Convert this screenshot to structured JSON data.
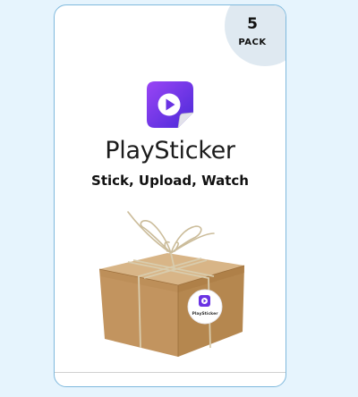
{
  "card": {
    "brand_name": "PlaySticker",
    "tagline": "Stick, Upload, Watch",
    "pack": {
      "count": "5",
      "label": "PACK"
    }
  },
  "parcel_sticker": {
    "brand_name": "PlaySticker"
  },
  "colors": {
    "background": "#e6f4fd",
    "card_border": "#7fb9dd",
    "icon_gradient_start": "#8b3df0",
    "icon_gradient_end": "#4b2ad6",
    "cardboard": "#c49a68",
    "twine": "#cdbf9f"
  },
  "icons": {
    "app_icon": "play-sticker-icon",
    "parcel_image": "cardboard-box-with-twine"
  }
}
